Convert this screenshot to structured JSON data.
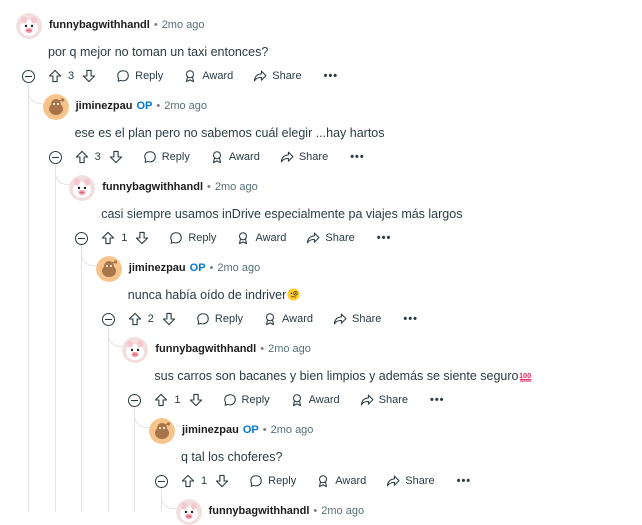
{
  "actions": {
    "reply": "Reply",
    "award": "Award",
    "share": "Share",
    "more": "•••"
  },
  "comments": [
    {
      "author": "funnybagwithhandl",
      "op": "",
      "time": "2mo ago",
      "text": "por q mejor no toman un taxi entonces?",
      "emoji": "",
      "votes": "3",
      "avatar": "pig"
    },
    {
      "author": "jiminezpau",
      "op": "OP",
      "time": "2mo ago",
      "text": "ese es el plan pero no sabemos cuál elegir ...hay hartos",
      "emoji": "",
      "votes": "3",
      "avatar": "snoo"
    },
    {
      "author": "funnybagwithhandl",
      "op": "",
      "time": "2mo ago",
      "text": "casi siempre usamos inDrive especialmente pa viajes más largos",
      "emoji": "",
      "votes": "1",
      "avatar": "pig"
    },
    {
      "author": "jiminezpau",
      "op": "OP",
      "time": "2mo ago",
      "text": "nunca había oído de indriver",
      "emoji": "monocle-face",
      "votes": "2",
      "avatar": "snoo"
    },
    {
      "author": "funnybagwithhandl",
      "op": "",
      "time": "2mo ago",
      "text": "sus carros son bacanes y bien limpios y además se siente seguro",
      "emoji": "hundred-points",
      "votes": "1",
      "avatar": "pig"
    },
    {
      "author": "jiminezpau",
      "op": "OP",
      "time": "2mo ago",
      "text": "q tal los choferes?",
      "emoji": "",
      "votes": "1",
      "avatar": "snoo"
    },
    {
      "author": "funnybagwithhandl",
      "op": "",
      "time": "2mo ago",
      "text": "",
      "emoji": "",
      "votes": "",
      "avatar": "pig"
    }
  ]
}
